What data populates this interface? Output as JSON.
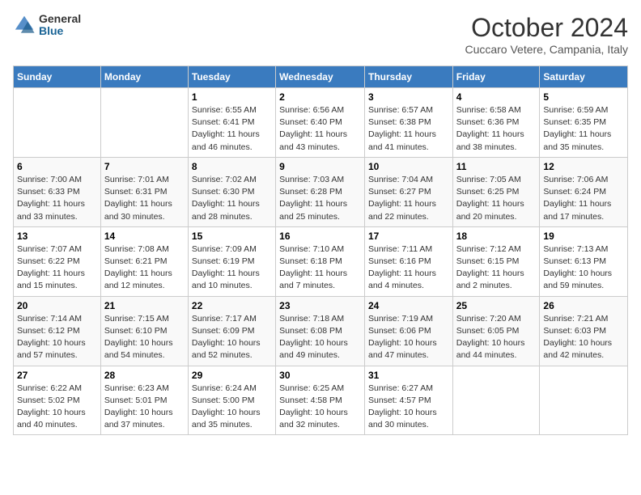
{
  "logo": {
    "general": "General",
    "blue": "Blue"
  },
  "header": {
    "month": "October 2024",
    "location": "Cuccaro Vetere, Campania, Italy"
  },
  "weekdays": [
    "Sunday",
    "Monday",
    "Tuesday",
    "Wednesday",
    "Thursday",
    "Friday",
    "Saturday"
  ],
  "weeks": [
    [
      {
        "day": "",
        "info": ""
      },
      {
        "day": "",
        "info": ""
      },
      {
        "day": "1",
        "info": "Sunrise: 6:55 AM\nSunset: 6:41 PM\nDaylight: 11 hours and 46 minutes."
      },
      {
        "day": "2",
        "info": "Sunrise: 6:56 AM\nSunset: 6:40 PM\nDaylight: 11 hours and 43 minutes."
      },
      {
        "day": "3",
        "info": "Sunrise: 6:57 AM\nSunset: 6:38 PM\nDaylight: 11 hours and 41 minutes."
      },
      {
        "day": "4",
        "info": "Sunrise: 6:58 AM\nSunset: 6:36 PM\nDaylight: 11 hours and 38 minutes."
      },
      {
        "day": "5",
        "info": "Sunrise: 6:59 AM\nSunset: 6:35 PM\nDaylight: 11 hours and 35 minutes."
      }
    ],
    [
      {
        "day": "6",
        "info": "Sunrise: 7:00 AM\nSunset: 6:33 PM\nDaylight: 11 hours and 33 minutes."
      },
      {
        "day": "7",
        "info": "Sunrise: 7:01 AM\nSunset: 6:31 PM\nDaylight: 11 hours and 30 minutes."
      },
      {
        "day": "8",
        "info": "Sunrise: 7:02 AM\nSunset: 6:30 PM\nDaylight: 11 hours and 28 minutes."
      },
      {
        "day": "9",
        "info": "Sunrise: 7:03 AM\nSunset: 6:28 PM\nDaylight: 11 hours and 25 minutes."
      },
      {
        "day": "10",
        "info": "Sunrise: 7:04 AM\nSunset: 6:27 PM\nDaylight: 11 hours and 22 minutes."
      },
      {
        "day": "11",
        "info": "Sunrise: 7:05 AM\nSunset: 6:25 PM\nDaylight: 11 hours and 20 minutes."
      },
      {
        "day": "12",
        "info": "Sunrise: 7:06 AM\nSunset: 6:24 PM\nDaylight: 11 hours and 17 minutes."
      }
    ],
    [
      {
        "day": "13",
        "info": "Sunrise: 7:07 AM\nSunset: 6:22 PM\nDaylight: 11 hours and 15 minutes."
      },
      {
        "day": "14",
        "info": "Sunrise: 7:08 AM\nSunset: 6:21 PM\nDaylight: 11 hours and 12 minutes."
      },
      {
        "day": "15",
        "info": "Sunrise: 7:09 AM\nSunset: 6:19 PM\nDaylight: 11 hours and 10 minutes."
      },
      {
        "day": "16",
        "info": "Sunrise: 7:10 AM\nSunset: 6:18 PM\nDaylight: 11 hours and 7 minutes."
      },
      {
        "day": "17",
        "info": "Sunrise: 7:11 AM\nSunset: 6:16 PM\nDaylight: 11 hours and 4 minutes."
      },
      {
        "day": "18",
        "info": "Sunrise: 7:12 AM\nSunset: 6:15 PM\nDaylight: 11 hours and 2 minutes."
      },
      {
        "day": "19",
        "info": "Sunrise: 7:13 AM\nSunset: 6:13 PM\nDaylight: 10 hours and 59 minutes."
      }
    ],
    [
      {
        "day": "20",
        "info": "Sunrise: 7:14 AM\nSunset: 6:12 PM\nDaylight: 10 hours and 57 minutes."
      },
      {
        "day": "21",
        "info": "Sunrise: 7:15 AM\nSunset: 6:10 PM\nDaylight: 10 hours and 54 minutes."
      },
      {
        "day": "22",
        "info": "Sunrise: 7:17 AM\nSunset: 6:09 PM\nDaylight: 10 hours and 52 minutes."
      },
      {
        "day": "23",
        "info": "Sunrise: 7:18 AM\nSunset: 6:08 PM\nDaylight: 10 hours and 49 minutes."
      },
      {
        "day": "24",
        "info": "Sunrise: 7:19 AM\nSunset: 6:06 PM\nDaylight: 10 hours and 47 minutes."
      },
      {
        "day": "25",
        "info": "Sunrise: 7:20 AM\nSunset: 6:05 PM\nDaylight: 10 hours and 44 minutes."
      },
      {
        "day": "26",
        "info": "Sunrise: 7:21 AM\nSunset: 6:03 PM\nDaylight: 10 hours and 42 minutes."
      }
    ],
    [
      {
        "day": "27",
        "info": "Sunrise: 6:22 AM\nSunset: 5:02 PM\nDaylight: 10 hours and 40 minutes."
      },
      {
        "day": "28",
        "info": "Sunrise: 6:23 AM\nSunset: 5:01 PM\nDaylight: 10 hours and 37 minutes."
      },
      {
        "day": "29",
        "info": "Sunrise: 6:24 AM\nSunset: 5:00 PM\nDaylight: 10 hours and 35 minutes."
      },
      {
        "day": "30",
        "info": "Sunrise: 6:25 AM\nSunset: 4:58 PM\nDaylight: 10 hours and 32 minutes."
      },
      {
        "day": "31",
        "info": "Sunrise: 6:27 AM\nSunset: 4:57 PM\nDaylight: 10 hours and 30 minutes."
      },
      {
        "day": "",
        "info": ""
      },
      {
        "day": "",
        "info": ""
      }
    ]
  ]
}
